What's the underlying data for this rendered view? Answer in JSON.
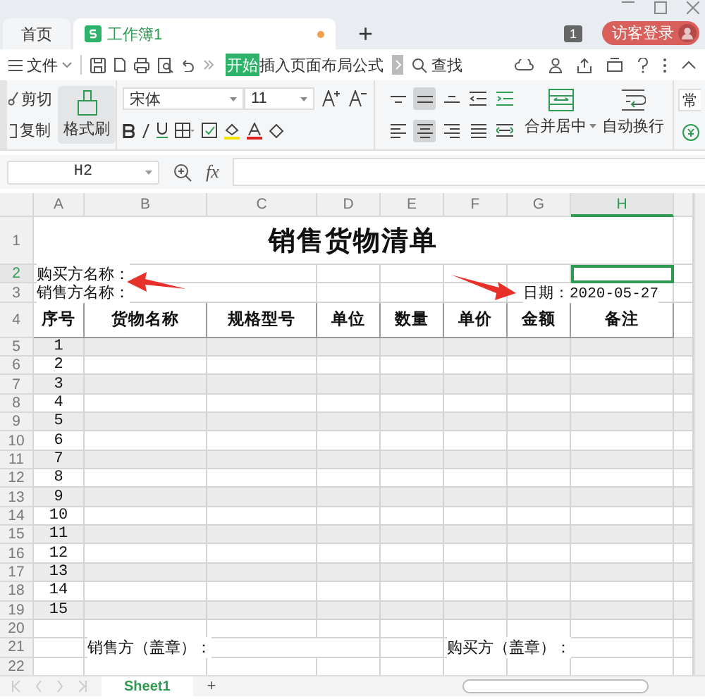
{
  "tabs": [
    {
      "label": "首页",
      "kind": "home",
      "selected": false
    },
    {
      "label": "工作簿1",
      "kind": "workbook",
      "selected": true,
      "unsaved": true
    }
  ],
  "new_tab": "+",
  "badge": "1",
  "login": "访客登录",
  "menu": {
    "file": "文件",
    "ribbon_tabs": [
      {
        "label": "开始",
        "selected": true
      },
      {
        "label": "插入",
        "selected": false
      },
      {
        "label": "页面布局",
        "selected": false
      },
      {
        "label": "公式",
        "selected": false
      }
    ],
    "search": "查找"
  },
  "ribbon": {
    "cut": "剪切",
    "copy": "复制",
    "painter": "格式刷",
    "font": "宋体",
    "size": "11",
    "align_buttons": [
      {
        "kind": "top",
        "selected": false
      },
      {
        "kind": "middle",
        "selected": true
      },
      {
        "kind": "bottom",
        "selected": false
      },
      {
        "kind": "left",
        "selected": false
      },
      {
        "kind": "center",
        "selected": true
      },
      {
        "kind": "right",
        "selected": false
      }
    ],
    "merge": "合并居中",
    "wrap": "自动换行",
    "style": "常"
  },
  "formula_bar": {
    "cell": "H2",
    "fx": "fx"
  },
  "sheet": {
    "columns": [
      {
        "label": "A",
        "selected": false
      },
      {
        "label": "B",
        "selected": false
      },
      {
        "label": "C",
        "selected": false
      },
      {
        "label": "D",
        "selected": false
      },
      {
        "label": "E",
        "selected": false
      },
      {
        "label": "F",
        "selected": false
      },
      {
        "label": "G",
        "selected": false
      },
      {
        "label": "H",
        "selected": true
      }
    ],
    "rows": [
      {
        "number": "1",
        "kind": "title",
        "selected": false,
        "shaded": false,
        "cells": [
          "",
          "",
          "",
          "销售货物清单"
        ]
      },
      {
        "number": "2",
        "kind": "info",
        "selected": true,
        "shaded": false,
        "cells": [
          "购买方名称："
        ]
      },
      {
        "number": "3",
        "kind": "info",
        "selected": false,
        "shaded": false,
        "cells": [
          "销售方名称：",
          "",
          "",
          "",
          "",
          "",
          "",
          "日期：2020-05-27"
        ]
      },
      {
        "number": "4",
        "kind": "header",
        "selected": false,
        "shaded": false,
        "cells": [
          "序号",
          "货物名称",
          "规格型号",
          "单位",
          "数量",
          "单价",
          "金额",
          "备注"
        ]
      },
      {
        "number": "5",
        "kind": "item",
        "selected": false,
        "shaded": true,
        "cells": [
          "1"
        ]
      },
      {
        "number": "6",
        "kind": "item",
        "selected": false,
        "shaded": false,
        "cells": [
          "2"
        ]
      },
      {
        "number": "7",
        "kind": "item",
        "selected": false,
        "shaded": true,
        "cells": [
          "3"
        ]
      },
      {
        "number": "8",
        "kind": "item",
        "selected": false,
        "shaded": false,
        "cells": [
          "4"
        ]
      },
      {
        "number": "9",
        "kind": "item",
        "selected": false,
        "shaded": true,
        "cells": [
          "5"
        ]
      },
      {
        "number": "10",
        "kind": "item",
        "selected": false,
        "shaded": false,
        "cells": [
          "6"
        ]
      },
      {
        "number": "11",
        "kind": "item",
        "selected": false,
        "shaded": true,
        "cells": [
          "7"
        ]
      },
      {
        "number": "12",
        "kind": "item",
        "selected": false,
        "shaded": false,
        "cells": [
          "8"
        ]
      },
      {
        "number": "13",
        "kind": "item",
        "selected": false,
        "shaded": true,
        "cells": [
          "9"
        ]
      },
      {
        "number": "14",
        "kind": "item",
        "selected": false,
        "shaded": false,
        "cells": [
          "10"
        ]
      },
      {
        "number": "15",
        "kind": "item",
        "selected": false,
        "shaded": true,
        "cells": [
          "11"
        ]
      },
      {
        "number": "16",
        "kind": "item",
        "selected": false,
        "shaded": false,
        "cells": [
          "12"
        ]
      },
      {
        "number": "17",
        "kind": "item",
        "selected": false,
        "shaded": true,
        "cells": [
          "13"
        ]
      },
      {
        "number": "18",
        "kind": "item",
        "selected": false,
        "shaded": false,
        "cells": [
          "14"
        ]
      },
      {
        "number": "19",
        "kind": "item",
        "selected": false,
        "shaded": true,
        "cells": [
          "15"
        ]
      },
      {
        "number": "20",
        "kind": "info",
        "selected": false,
        "shaded": false,
        "cells": []
      },
      {
        "number": "21",
        "kind": "info",
        "selected": false,
        "shaded": false,
        "cells": [
          "",
          "销售方（盖章）：",
          "",
          "",
          "",
          "购买方（盖章）："
        ]
      },
      {
        "number": "22",
        "kind": "info",
        "selected": false,
        "shaded": false,
        "cells": []
      }
    ]
  },
  "sheet_tabs": [
    {
      "label": "Sheet1",
      "selected": true
    }
  ],
  "add_sheet": "+"
}
